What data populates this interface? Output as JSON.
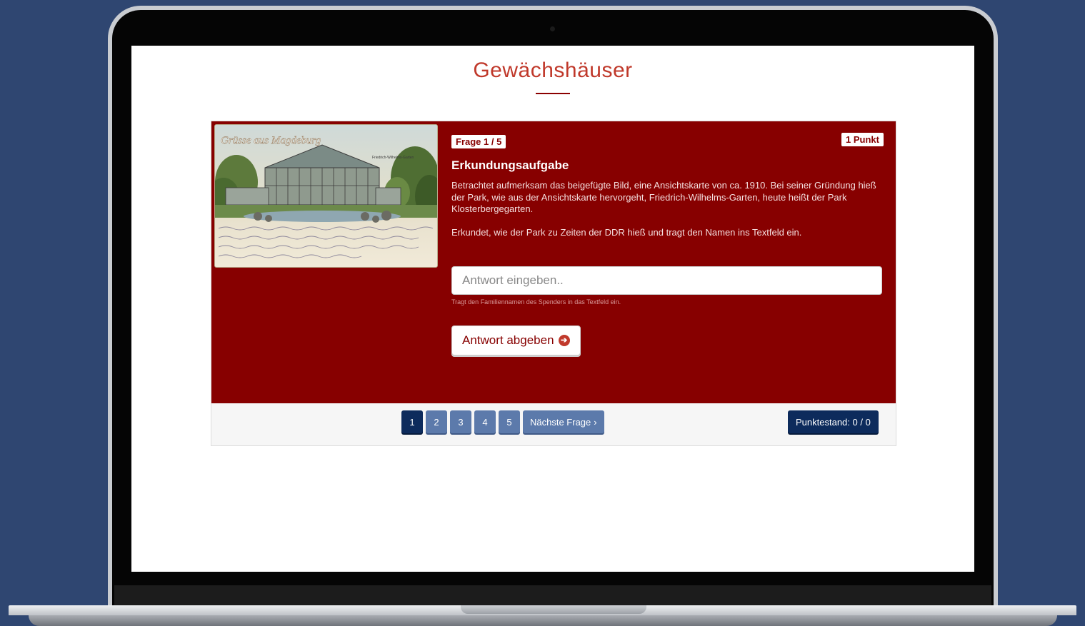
{
  "page": {
    "title": "Gewächshäuser"
  },
  "question": {
    "counter": "Frage 1 / 5",
    "points": "1 Punkt",
    "title": "Erkundungsaufgabe",
    "text1": "Betrachtet aufmerksam das beigefügte Bild, eine Ansichtskarte von ca. 1910. Bei seiner Gründung hieß der Park, wie aus der Ansichtskarte hervorgeht, Friedrich-Wilhelms-Garten, heute heißt der Park Klosterbergegarten.",
    "text2": "Erkundet, wie der Park zu Zeiten der DDR hieß und tragt den Namen ins Textfeld ein.",
    "image_icon": "postcard-greenhouse-image",
    "postcard_caption": "Grüsse aus Magdeburg",
    "postcard_sub": "Friedrich-Wilhelms-Garten"
  },
  "answer": {
    "placeholder": "Antwort eingeben..",
    "value": "",
    "help": "Tragt den Familiennamen des Spenders in das Textfeld ein.",
    "submit_label": "Antwort abgeben",
    "submit_icon": "arrow-circle-right-icon"
  },
  "pagination": {
    "pages": [
      "1",
      "2",
      "3",
      "4",
      "5"
    ],
    "active": "1",
    "next_label": "Nächste Frage",
    "next_icon": "chevron-right-icon"
  },
  "score": {
    "label": "Punktestand: 0 / 0"
  },
  "colors": {
    "background": "#2f4671",
    "accent": "#870000",
    "title": "#c0392b",
    "page_button": "#5c7aab",
    "active_button": "#0d2b5c"
  }
}
